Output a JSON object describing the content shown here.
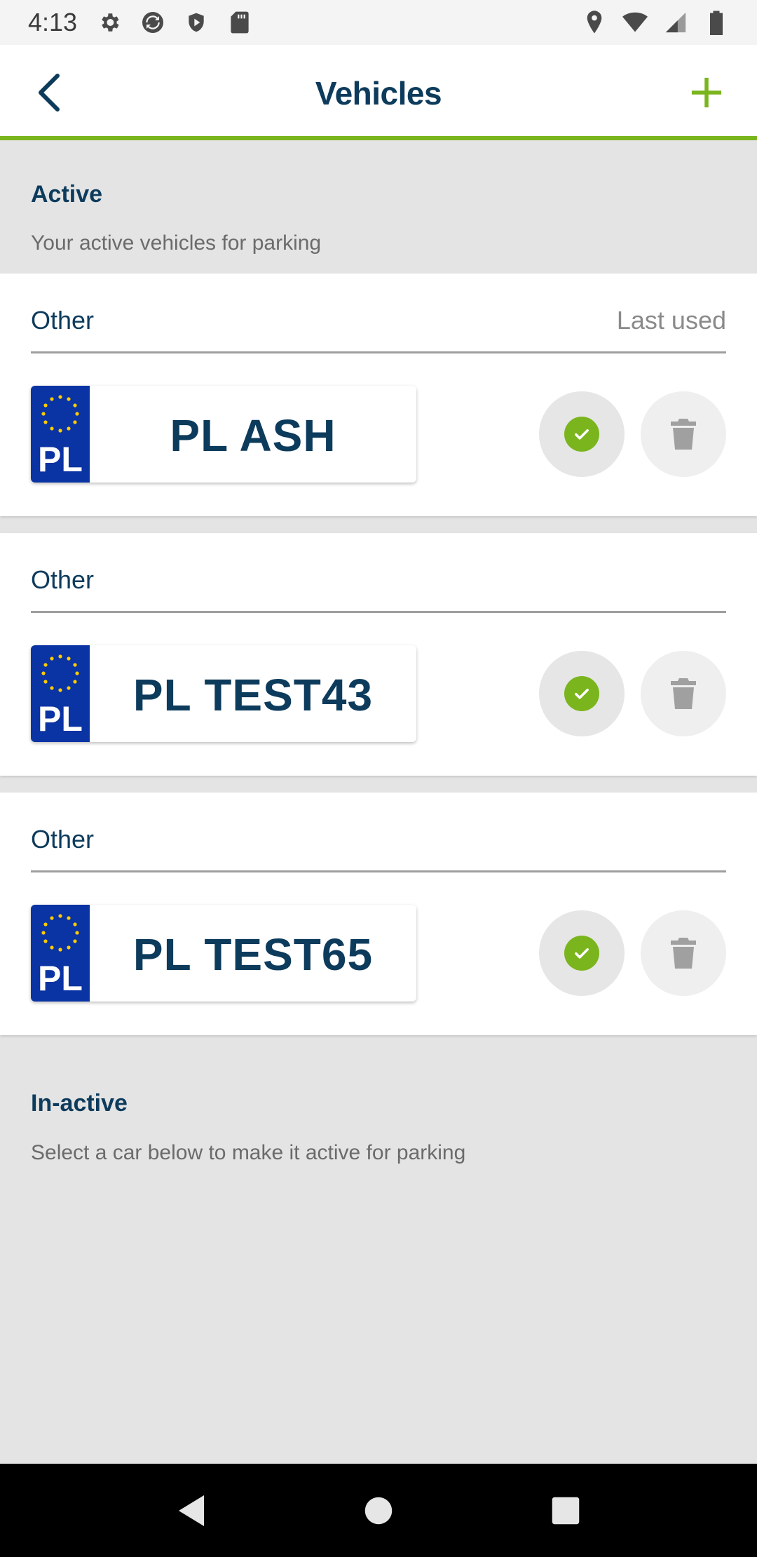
{
  "status_bar": {
    "time": "4:13",
    "left_icons": [
      "settings-icon",
      "sync-icon",
      "shield-icon",
      "sd-card-icon"
    ],
    "right_icons": [
      "location-icon",
      "wifi-icon",
      "signal-icon",
      "battery-icon"
    ]
  },
  "app_bar": {
    "title": "Vehicles",
    "back_icon": "chevron-left-icon",
    "add_icon": "plus-icon",
    "accent_color": "#7ab51d"
  },
  "active_section": {
    "title": "Active",
    "subtitle": "Your active vehicles for parking"
  },
  "vehicles": [
    {
      "type": "Other",
      "meta": "Last used",
      "country": "PL",
      "plate": "PL ASH"
    },
    {
      "type": "Other",
      "meta": "",
      "country": "PL",
      "plate": "PL TEST43"
    },
    {
      "type": "Other",
      "meta": "",
      "country": "PL",
      "plate": "PL TEST65"
    }
  ],
  "inactive_section": {
    "title": "In-active",
    "subtitle": "Select a car below to make it active for parking"
  },
  "nav_bar": {
    "icons": [
      "back-triangle-icon",
      "home-circle-icon",
      "recents-square-icon"
    ]
  },
  "colors": {
    "primary_text": "#0d3b5c",
    "accent": "#7ab51d",
    "plate_blue": "#0a33a3"
  }
}
